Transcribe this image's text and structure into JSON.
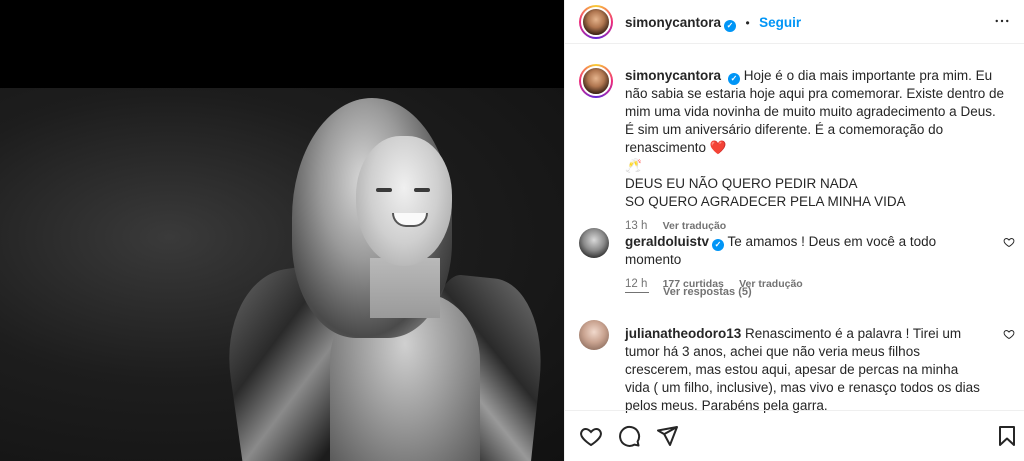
{
  "post": {
    "author": "simonycantora",
    "follow_label": "Seguir",
    "dot": "•",
    "verified_mark": "✓",
    "caption": {
      "lines": [
        "Hoje é o dia mais importante pra mim. Eu não",
        "sabia se estaria hoje aqui pra comemorar. Existe dentro de mim",
        "uma vida novinha de muito muito agradecimento a Deus. É sim",
        "um aniversário diferente. É a comemoração do renascimento",
        "DEUS EU NÃO QUERO PEDIR NADA",
        "SO QUERO AGRADECER PELA MINHA VIDA"
      ],
      "heart": "❤️",
      "toast": "🥂",
      "time": "13 h",
      "translate": "Ver tradução"
    }
  },
  "comments": [
    {
      "user": "geraldoluistv",
      "text": "Te amamos ! Deus em você a todo momento",
      "time": "12 h",
      "likes": "177 curtidas",
      "translate": "Ver tradução",
      "replies": "Ver respostas (5)"
    },
    {
      "user": "julianatheodoro13",
      "text_lines": [
        "Renascimento é a palavra ! Tirei um tumor",
        "há 3 anos, achei que não veria meus filhos crescerem, mas",
        "estou aqui, apesar de percas na minha vida ( um filho,",
        "inclusive), mas vivo e renasço todos os dias pelos meus.",
        "Parabéns pela garra."
      ]
    }
  ],
  "icons": {
    "more": "more-horizontal-icon",
    "like": "heart-icon",
    "comment": "comment-icon",
    "share": "share-icon",
    "save": "bookmark-icon"
  },
  "colors": {
    "link_blue": "#0095f6",
    "secondary_text": "#737373",
    "heart_red": "#e0245e"
  }
}
